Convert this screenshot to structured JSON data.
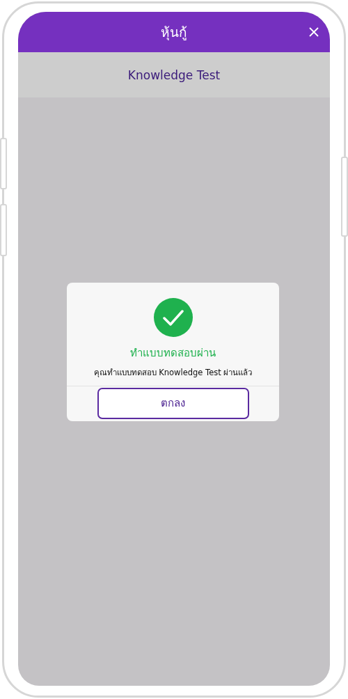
{
  "app_bar": {
    "title": "หุ้นกู้"
  },
  "subheader": {
    "title": "Knowledge Test"
  },
  "dialog": {
    "title": "ทำแบบทดสอบผ่าน",
    "message": "คุณทำแบบทดสอบ Knowledge Test ผ่านแล้ว",
    "buttons": [
      "ตกลง"
    ]
  }
}
